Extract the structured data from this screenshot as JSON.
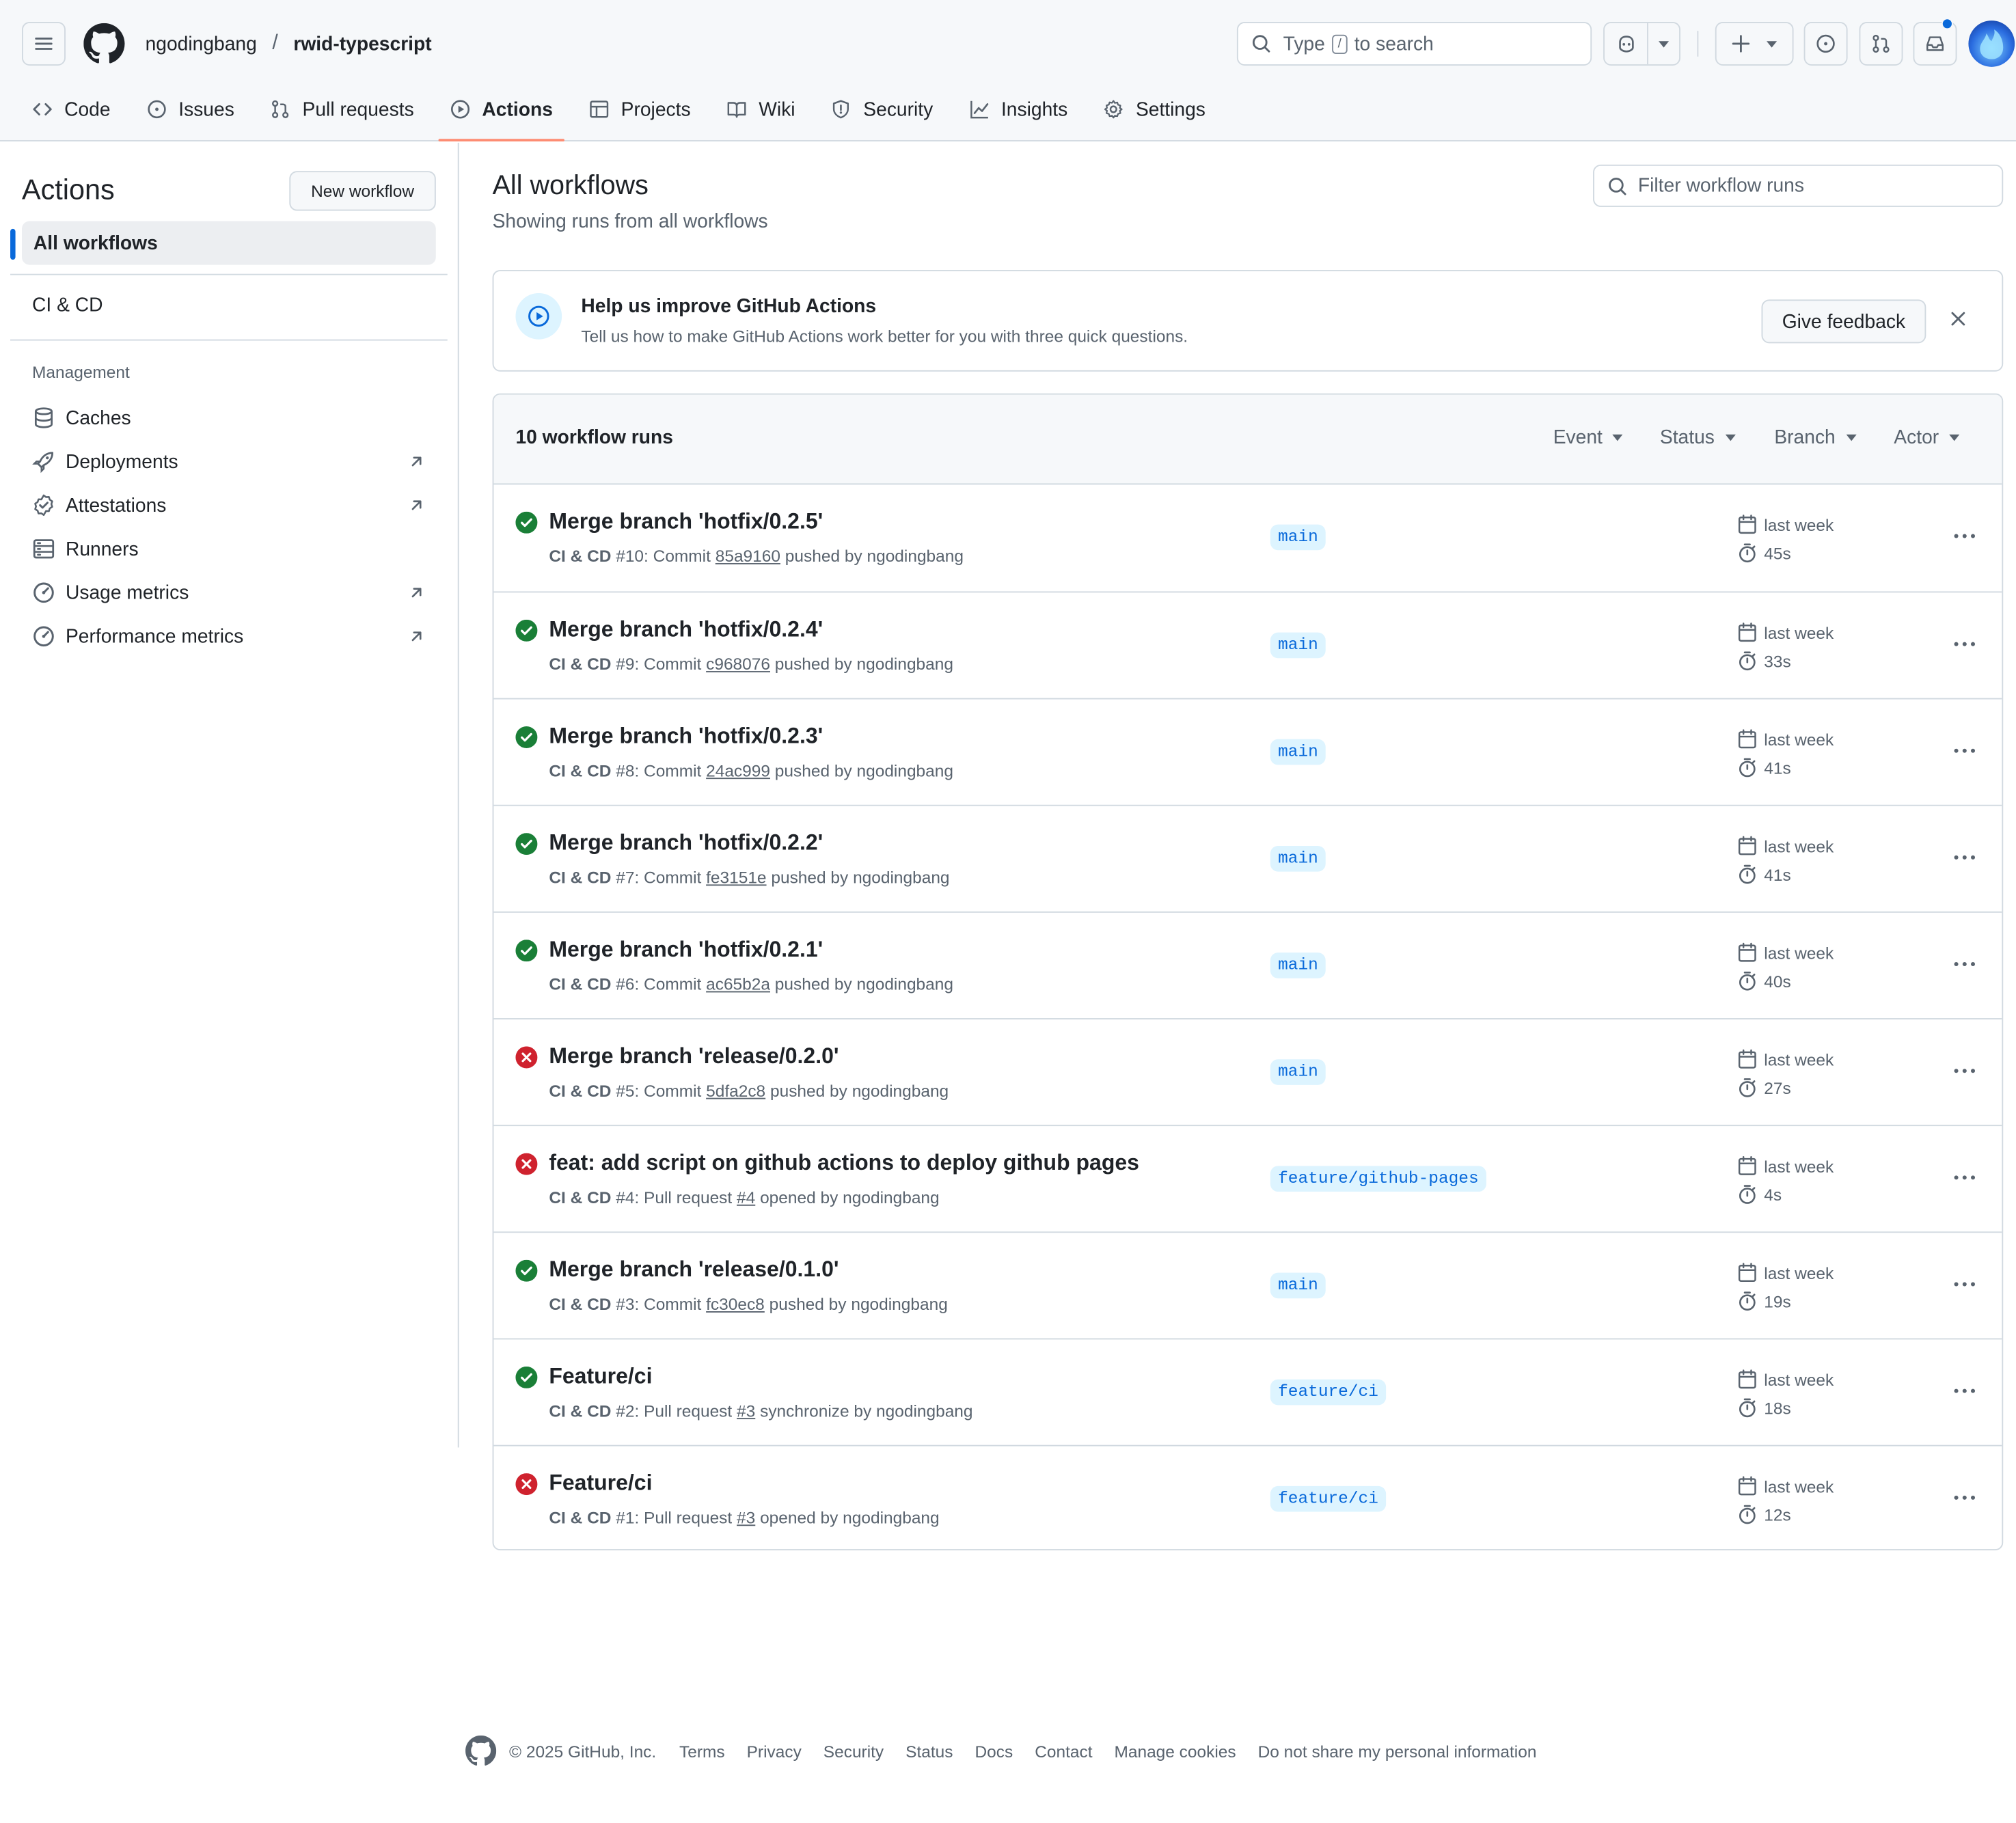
{
  "header": {
    "owner": "ngodingbang",
    "separator": "/",
    "repo": "rwid-typescript",
    "search_prefix": "Type",
    "search_key": "/",
    "search_suffix": "to search"
  },
  "tabs": [
    {
      "label": "Code",
      "icon": "code-icon"
    },
    {
      "label": "Issues",
      "icon": "issue-opened-icon"
    },
    {
      "label": "Pull requests",
      "icon": "git-pull-request-icon"
    },
    {
      "label": "Actions",
      "icon": "play-icon",
      "active": true
    },
    {
      "label": "Projects",
      "icon": "table-icon"
    },
    {
      "label": "Wiki",
      "icon": "book-icon"
    },
    {
      "label": "Security",
      "icon": "shield-icon"
    },
    {
      "label": "Insights",
      "icon": "graph-icon"
    },
    {
      "label": "Settings",
      "icon": "gear-icon"
    }
  ],
  "sidebar": {
    "title": "Actions",
    "new_workflow": "New workflow",
    "all_workflows": "All workflows",
    "workflow": "CI & CD",
    "management_heading": "Management",
    "management": [
      {
        "label": "Caches",
        "icon": "database-icon",
        "external": false
      },
      {
        "label": "Deployments",
        "icon": "rocket-icon",
        "external": true
      },
      {
        "label": "Attestations",
        "icon": "verified-icon",
        "external": true
      },
      {
        "label": "Runners",
        "icon": "server-icon",
        "external": false
      },
      {
        "label": "Usage metrics",
        "icon": "meter-icon",
        "external": true
      },
      {
        "label": "Performance metrics",
        "icon": "meter-icon",
        "external": true
      }
    ]
  },
  "main": {
    "title": "All workflows",
    "subtitle": "Showing runs from all workflows",
    "filter_placeholder": "Filter workflow runs"
  },
  "banner": {
    "title": "Help us improve GitHub Actions",
    "description": "Tell us how to make GitHub Actions work better for you with three quick questions.",
    "button": "Give feedback"
  },
  "runs_header": {
    "count": "10 workflow runs",
    "filters": [
      "Event",
      "Status",
      "Branch",
      "Actor"
    ]
  },
  "runs": [
    {
      "status": "success",
      "title": "Merge branch 'hotfix/0.2.5'",
      "workflow": "CI & CD",
      "number": "#10",
      "kind": "Commit",
      "ref": "85a9160",
      "action": "pushed by",
      "actor": "ngodingbang",
      "branch": "main",
      "when": "last week",
      "duration": "45s"
    },
    {
      "status": "success",
      "title": "Merge branch 'hotfix/0.2.4'",
      "workflow": "CI & CD",
      "number": "#9",
      "kind": "Commit",
      "ref": "c968076",
      "action": "pushed by",
      "actor": "ngodingbang",
      "branch": "main",
      "when": "last week",
      "duration": "33s"
    },
    {
      "status": "success",
      "title": "Merge branch 'hotfix/0.2.3'",
      "workflow": "CI & CD",
      "number": "#8",
      "kind": "Commit",
      "ref": "24ac999",
      "action": "pushed by",
      "actor": "ngodingbang",
      "branch": "main",
      "when": "last week",
      "duration": "41s"
    },
    {
      "status": "success",
      "title": "Merge branch 'hotfix/0.2.2'",
      "workflow": "CI & CD",
      "number": "#7",
      "kind": "Commit",
      "ref": "fe3151e",
      "action": "pushed by",
      "actor": "ngodingbang",
      "branch": "main",
      "when": "last week",
      "duration": "41s"
    },
    {
      "status": "success",
      "title": "Merge branch 'hotfix/0.2.1'",
      "workflow": "CI & CD",
      "number": "#6",
      "kind": "Commit",
      "ref": "ac65b2a",
      "action": "pushed by",
      "actor": "ngodingbang",
      "branch": "main",
      "when": "last week",
      "duration": "40s"
    },
    {
      "status": "failure",
      "title": "Merge branch 'release/0.2.0'",
      "workflow": "CI & CD",
      "number": "#5",
      "kind": "Commit",
      "ref": "5dfa2c8",
      "action": "pushed by",
      "actor": "ngodingbang",
      "branch": "main",
      "when": "last week",
      "duration": "27s"
    },
    {
      "status": "failure",
      "title": "feat: add script on github actions to deploy github pages",
      "workflow": "CI & CD",
      "number": "#4",
      "kind": "Pull request",
      "ref": "#4",
      "action": "opened by",
      "actor": "ngodingbang",
      "branch": "feature/github-pages",
      "when": "last week",
      "duration": "4s"
    },
    {
      "status": "success",
      "title": "Merge branch 'release/0.1.0'",
      "workflow": "CI & CD",
      "number": "#3",
      "kind": "Commit",
      "ref": "fc30ec8",
      "action": "pushed by",
      "actor": "ngodingbang",
      "branch": "main",
      "when": "last week",
      "duration": "19s"
    },
    {
      "status": "success",
      "title": "Feature/ci",
      "workflow": "CI & CD",
      "number": "#2",
      "kind": "Pull request",
      "ref": "#3",
      "action": "synchronize by",
      "actor": "ngodingbang",
      "branch": "feature/ci",
      "when": "last week",
      "duration": "18s"
    },
    {
      "status": "failure",
      "title": "Feature/ci",
      "workflow": "CI & CD",
      "number": "#1",
      "kind": "Pull request",
      "ref": "#3",
      "action": "opened by",
      "actor": "ngodingbang",
      "branch": "feature/ci",
      "when": "last week",
      "duration": "12s"
    }
  ],
  "footer": {
    "copyright": "© 2025 GitHub, Inc.",
    "links": [
      "Terms",
      "Privacy",
      "Security",
      "Status",
      "Docs",
      "Contact",
      "Manage cookies",
      "Do not share my personal information"
    ]
  },
  "colors": {
    "success": "#1a7f37",
    "failure": "#cf222e",
    "accent": "#0969da",
    "active_tab_underline": "#fd8c73"
  }
}
